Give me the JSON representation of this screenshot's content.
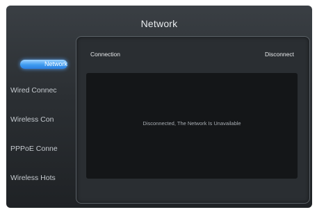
{
  "screen": {
    "title": "Network"
  },
  "sidebar": {
    "items": [
      {
        "label": "Network",
        "active": true
      },
      {
        "label": "Wired Connec",
        "active": false
      },
      {
        "label": "Wireless Con",
        "active": false
      },
      {
        "label": "PPPoE Conne",
        "active": false
      },
      {
        "label": "Wireless Hots",
        "active": false
      }
    ]
  },
  "panel": {
    "connection_label": "Connection",
    "status_label": "Disconnect",
    "message": "Disconnected, The Network Is Unavailable"
  },
  "colors": {
    "accent": "#3f9cf0",
    "background": "#2b2f33",
    "content_box": "#141618"
  }
}
